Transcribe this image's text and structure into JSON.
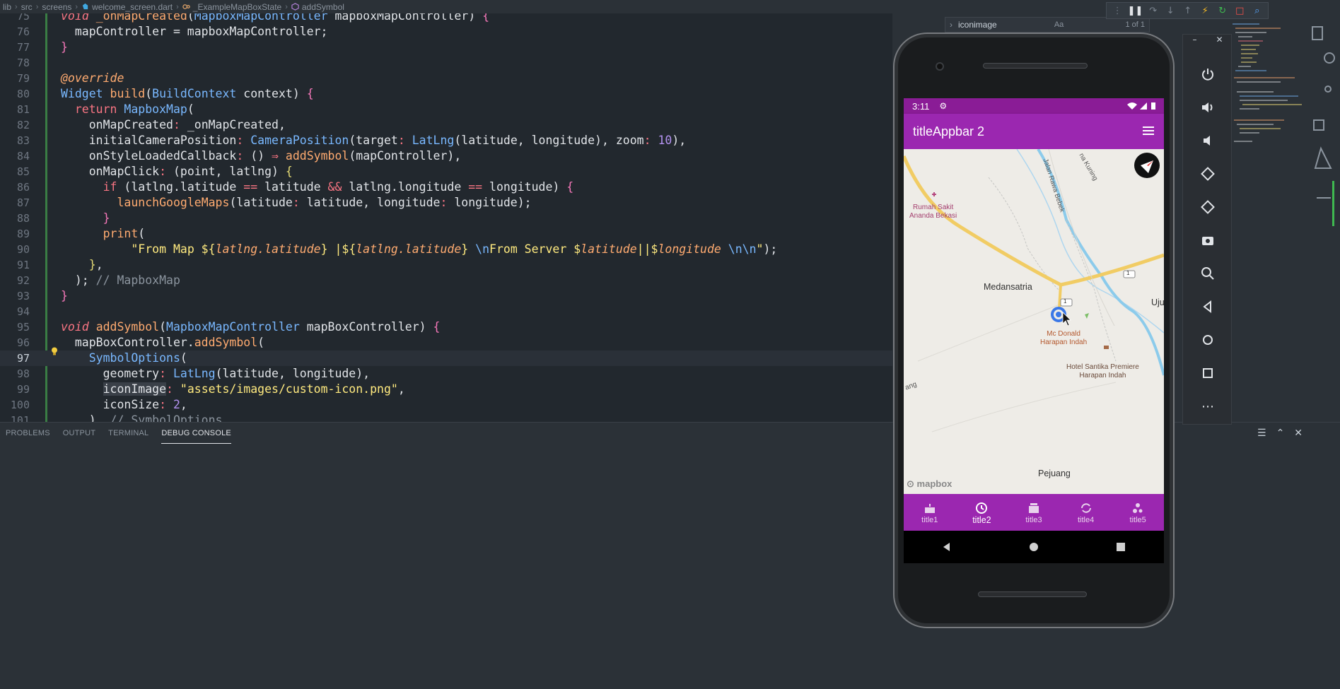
{
  "breadcrumb": {
    "items": [
      "lib",
      "src",
      "screens",
      "welcome_screen.dart",
      "_ExampleMapBoxState",
      "addSymbol"
    ]
  },
  "find": {
    "query": "iconimage",
    "options": "Aa",
    "count": "1 of 1"
  },
  "editor": {
    "line_numbers": [
      "75",
      "76",
      "77",
      "78",
      "79",
      "80",
      "81",
      "82",
      "83",
      "84",
      "85",
      "86",
      "87",
      "88",
      "89",
      "90",
      "91",
      "92",
      "93",
      "94",
      "95",
      "96",
      "97",
      "98",
      "99",
      "100",
      "101"
    ],
    "current_line": "97"
  },
  "panel": {
    "tabs": [
      "PROBLEMS",
      "OUTPUT",
      "TERMINAL",
      "DEBUG CONSOLE"
    ],
    "active_tab": "DEBUG CONSOLE"
  },
  "phone": {
    "time": "3:11",
    "appbar_title": "titleAppbar 2",
    "tabs": [
      "title1",
      "title2",
      "title3",
      "title4",
      "title5"
    ],
    "selected_tab": "title2",
    "map": {
      "attribution": "mapbox",
      "places": {
        "hospital": "Rumah Sakit\nAnanda Bekasi",
        "town": "Medansatria",
        "mcd": "Mc Donald\nHarapan Indah",
        "hotel": "Hotel Santika Premiere\nHarapan Indah",
        "pejuang": "Pejuang",
        "uju": "Uju",
        "road1": "Jalan Rawa Bebek",
        "road2": "na Kuning",
        "ang": "ang",
        "shield": "1"
      }
    }
  },
  "colors": {
    "appbar": "#9b27b0",
    "statusbar": "#8a1c96",
    "editor_bg": "#22282e",
    "panel_bg": "#2b3137"
  }
}
